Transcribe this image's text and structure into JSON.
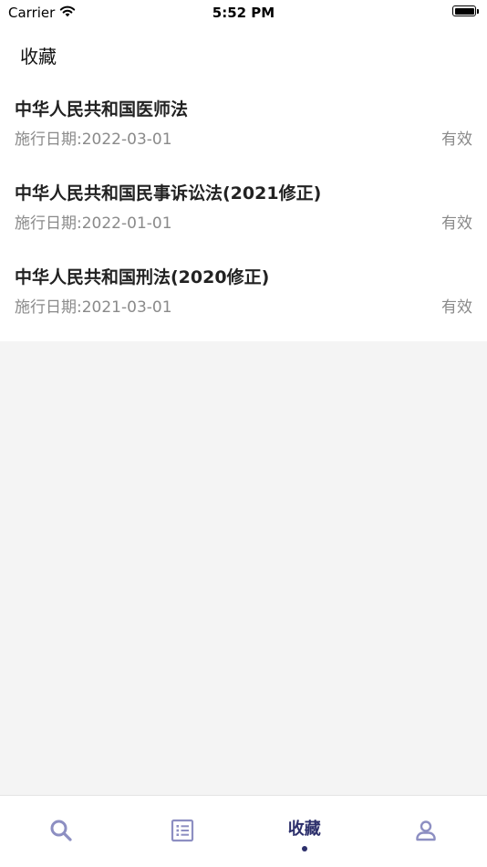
{
  "status_bar": {
    "carrier": "Carrier",
    "time": "5:52 PM"
  },
  "page": {
    "title": "收藏"
  },
  "laws": [
    {
      "title": "中华人民共和国医师法",
      "date": "施行日期:2022-03-01",
      "status": "有效"
    },
    {
      "title": "中华人民共和国民事诉讼法(2021修正)",
      "date": "施行日期:2022-01-01",
      "status": "有效"
    },
    {
      "title": "中华人民共和国刑法(2020修正)",
      "date": "施行日期:2021-03-01",
      "status": "有效"
    }
  ],
  "tab_bar": {
    "tabs": [
      {
        "icon": "search-icon"
      },
      {
        "icon": "list-icon"
      },
      {
        "label": "收藏",
        "active": true
      },
      {
        "icon": "person-icon"
      }
    ]
  },
  "colors": {
    "accent": "#2c2f6b",
    "inactive_icon": "#8d8fc2",
    "background": "#f4f4f4"
  }
}
